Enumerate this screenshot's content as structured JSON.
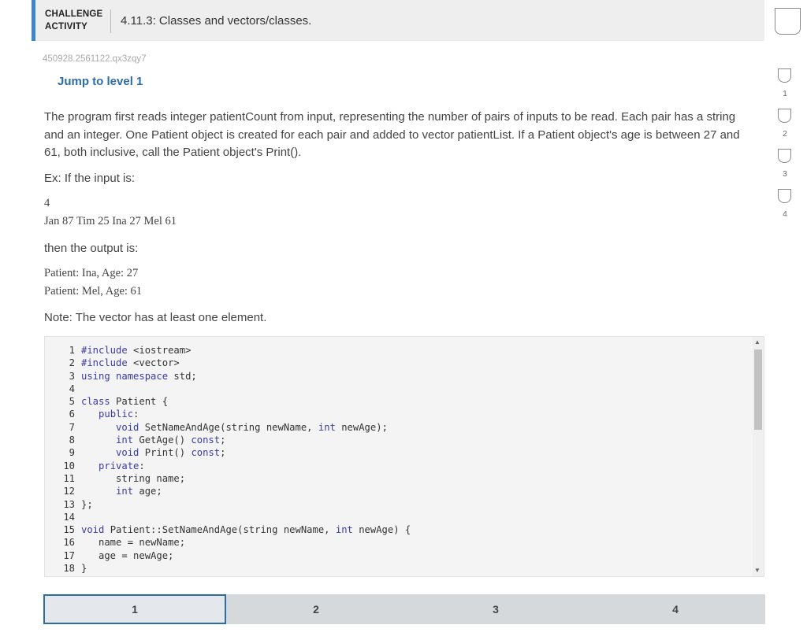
{
  "header": {
    "label_line1": "CHALLENGE",
    "label_line2": "ACTIVITY",
    "title": "4.11.3: Classes and vectors/classes."
  },
  "seed": "450928.2561122.qx3zqy7",
  "jump_link": "Jump to level 1",
  "description": "The program first reads integer patientCount from input, representing the number of pairs of inputs to be read. Each pair has a string and an integer. One Patient object is created for each pair and added to vector patientList. If a Patient object's age is between 27 and 61, both inclusive, call the Patient object's Print().",
  "example": {
    "intro": "Ex: If the input is:",
    "input_line1": "4",
    "input_line2": "Jan 87 Tim 25 Ina 27 Mel 61",
    "then": "then the output is:",
    "output_line1": "Patient: Ina, Age: 27",
    "output_line2": "Patient: Mel, Age: 61"
  },
  "note": "Note: The vector has at least one element.",
  "code_lines": [
    "#include <iostream>",
    "#include <vector>",
    "using namespace std;",
    "",
    "class Patient {",
    "   public:",
    "      void SetNameAndAge(string newName, int newAge);",
    "      int GetAge() const;",
    "      void Print() const;",
    "   private:",
    "      string name;",
    "      int age;",
    "};",
    "",
    "void Patient::SetNameAndAge(string newName, int newAge) {",
    "   name = newName;",
    "   age = newAge;",
    "}"
  ],
  "levels": [
    "1",
    "2",
    "3",
    "4"
  ],
  "active_level": "1",
  "progress_numbers": [
    "1",
    "2",
    "3",
    "4"
  ],
  "colors": {
    "accent": "#3d87c7",
    "link": "#2d6ca8",
    "level_active_border": "#2f6ca0"
  }
}
